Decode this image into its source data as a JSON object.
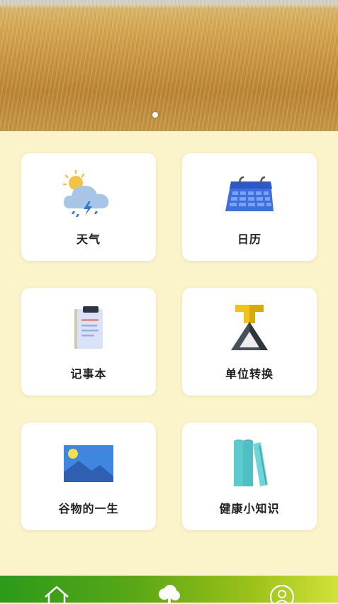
{
  "banner": {
    "indicator_count": 1,
    "active_index": 0
  },
  "menu": {
    "items": [
      {
        "label": "天气",
        "icon": "weather-cloud-storm-icon"
      },
      {
        "label": "日历",
        "icon": "calendar-icon"
      },
      {
        "label": "记事本",
        "icon": "clipboard-notepad-icon"
      },
      {
        "label": "单位转换",
        "icon": "conversion-stand-icon"
      },
      {
        "label": "谷物的一生",
        "icon": "landscape-picture-icon"
      },
      {
        "label": "健康小知识",
        "icon": "books-icon"
      }
    ]
  },
  "tabbar": {
    "tabs": [
      {
        "icon": "home-icon"
      },
      {
        "icon": "tree-icon"
      },
      {
        "icon": "user-profile-icon"
      }
    ]
  }
}
